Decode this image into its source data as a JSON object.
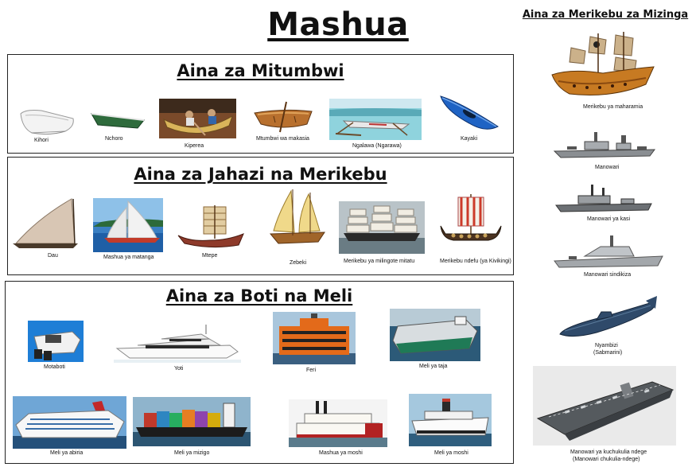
{
  "page": {
    "title": "Mashua",
    "side_title": "Aina za Merikebu za Mizinga"
  },
  "sections": [
    {
      "title": "Aina za Mitumbwi",
      "items": [
        "Kihori",
        "Nchoro",
        "Kiperea",
        "Mtumbwi wa makasia",
        "Ngalawa (Ngarawa)",
        "Kayaki"
      ]
    },
    {
      "title": "Aina za Jahazi na Merikebu",
      "items": [
        "Dau",
        "Mashua ya matanga",
        "Mtepe",
        "Zebeki",
        "Merikebu ya milingote mitatu",
        "Merikebu ndefu (ya Kivikingi)"
      ]
    },
    {
      "title": "Aina za Boti na Meli",
      "items": [
        "Motaboti",
        "Yoti",
        "Feri",
        "Meli ya taja",
        "Meli ya abiria",
        "Meli ya mizigo",
        "Mashua ya moshi",
        "Meli ya moshi"
      ]
    }
  ],
  "side_items": [
    "Merikebu ya maharamia",
    "Manowari",
    "Manowari ya kasi",
    "Manowari sindikiza",
    "Nyambizi",
    "(Sabmarini)",
    "Manowari ya kuchukulia ndege",
    "(Manowari chukulia-ndege)"
  ]
}
